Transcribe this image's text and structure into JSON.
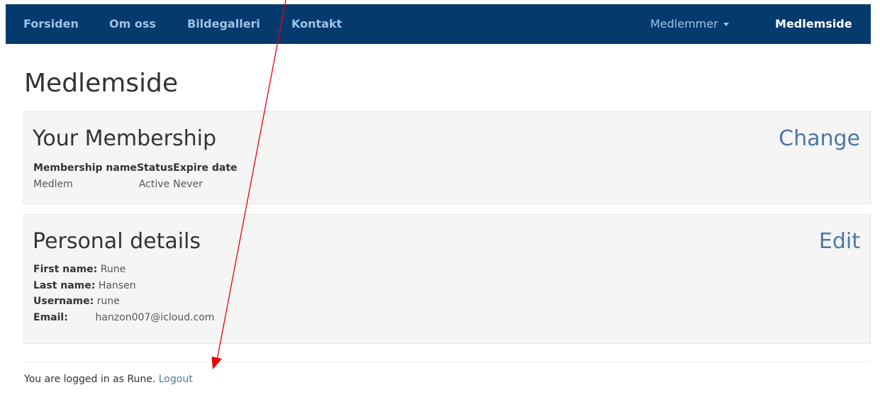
{
  "nav": {
    "items": [
      {
        "label": "Forsiden"
      },
      {
        "label": "Om oss"
      },
      {
        "label": "Bildegalleri"
      },
      {
        "label": "Kontakt"
      }
    ],
    "dropdown_label": "Medlemmer",
    "active_label": "Medlemside",
    "bg_color": "#043a6e"
  },
  "page_title": "Medlemside",
  "membership": {
    "title": "Your Membership",
    "action_label": "Change",
    "columns": [
      "Membership name",
      "Status",
      "Expire date"
    ],
    "rows": [
      [
        "Medlem",
        "Active",
        "Never"
      ]
    ]
  },
  "personal": {
    "title": "Personal details",
    "action_label": "Edit",
    "fields": [
      {
        "label": "First name:",
        "value": "Rune"
      },
      {
        "label": "Last name:",
        "value": "Hansen"
      },
      {
        "label": "Username:",
        "value": "rune"
      },
      {
        "label": "Email:",
        "value": "hanzon007@icloud.com"
      }
    ]
  },
  "footer": {
    "text": "You are logged in as Rune.",
    "logout_label": "Logout"
  },
  "annotation_color": "#e8000b"
}
